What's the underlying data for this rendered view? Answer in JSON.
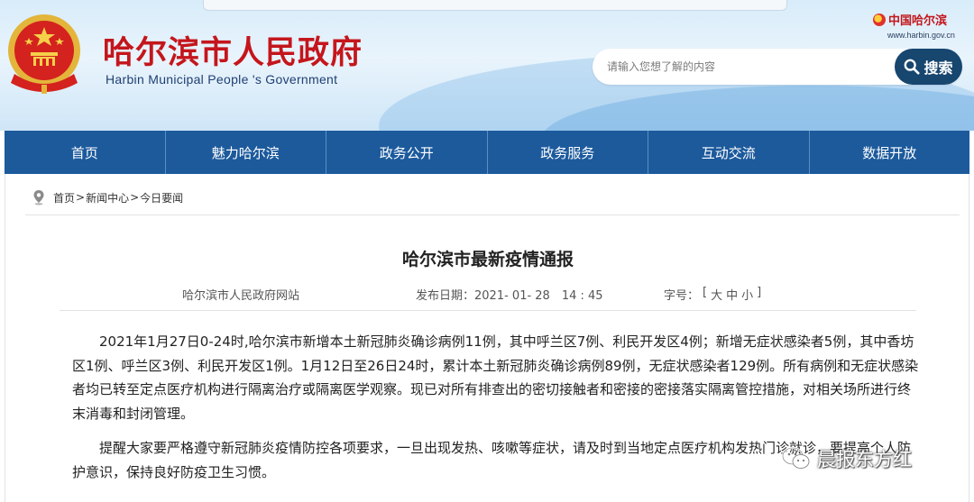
{
  "header": {
    "site_title": "哈尔滨市人民政府",
    "site_subtitle": "Harbin Municipal People 's Government",
    "right_logo_text": "中国哈尔滨",
    "right_logo_url": "www.harbin.gov.cn"
  },
  "search": {
    "placeholder": "请输入您想了解的内容",
    "button_label": "搜索"
  },
  "nav": {
    "items": [
      {
        "label": "首页"
      },
      {
        "label": "魅力哈尔滨"
      },
      {
        "label": "政务公开"
      },
      {
        "label": "政务服务"
      },
      {
        "label": "互动交流"
      },
      {
        "label": "数据开放"
      }
    ]
  },
  "breadcrumb": {
    "items": [
      "首页",
      "新闻中心",
      "今日要闻"
    ],
    "separator": ">"
  },
  "article": {
    "title": "哈尔滨市最新疫情通报",
    "source": "哈尔滨市人民政府网站",
    "date_label": "发布日期：",
    "date_value": "2021- 01- 28　14 : 45",
    "font_size_label": "字号：",
    "font_size_open": "[",
    "font_size_large": "大",
    "font_size_medium": "中",
    "font_size_small": "小",
    "font_size_close": "]",
    "paragraphs": [
      "2021年1月27日0-24时,哈尔滨市新增本土新冠肺炎确诊病例11例，其中呼兰区7例、利民开发区4例；新增无症状感染者5例，其中香坊区1例、呼兰区3例、利民开发区1例。1月12日至26日24时，累计本土新冠肺炎确诊病例89例，无症状感染者129例。所有病例和无症状感染者均已转至定点医疗机构进行隔离治疗或隔离医学观察。现已对所有排查出的密切接触者和密接的密接落实隔离管控措施，对相关场所进行终末消毒和封闭管理。",
      "提醒大家要严格遵守新冠肺炎疫情防控各项要求，一旦出现发热、咳嗽等症状，请及时到当地定点医疗机构发热门诊就诊，要提高个人防护意识，保持良好防疫卫生习惯。"
    ]
  },
  "watermark": {
    "text": "晨报东方红",
    "icon": "wechat-icon"
  },
  "colors": {
    "nav_bg": "#1c5a9c",
    "title_red": "#c4161c",
    "search_button": "#17466f"
  }
}
